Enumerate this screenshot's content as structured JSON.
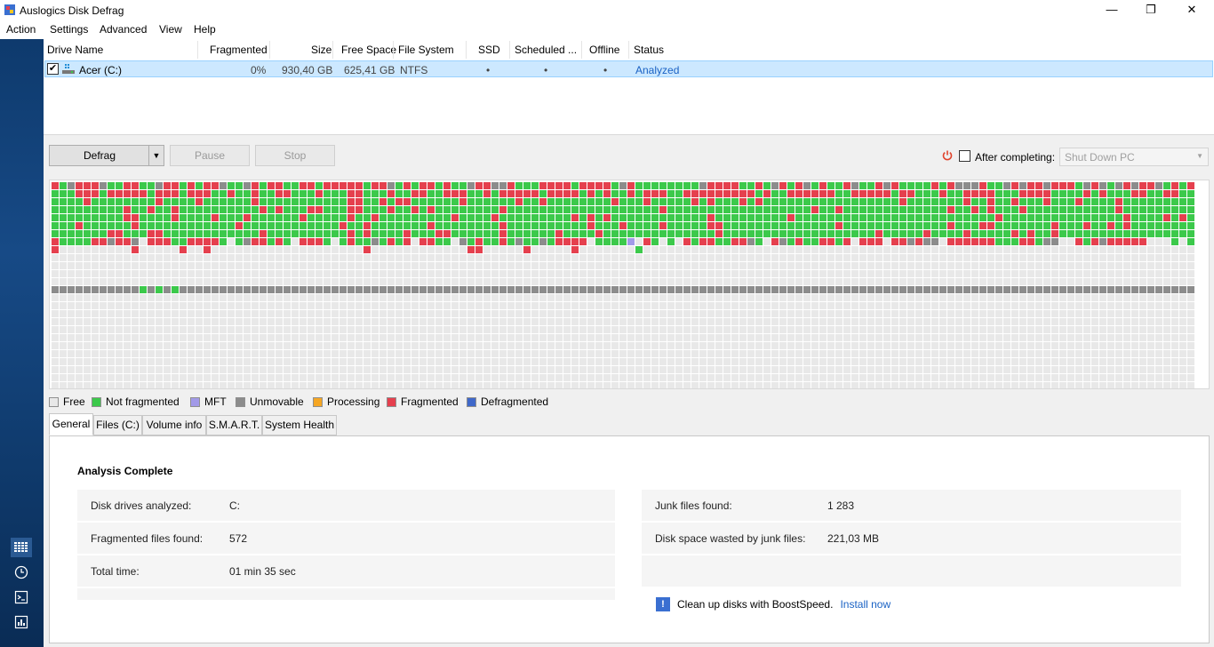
{
  "window": {
    "title": "Auslogics Disk Defrag",
    "minimize_glyph": "—",
    "maximize_glyph": "❐",
    "close_glyph": "✕"
  },
  "menu": [
    "Action",
    "Settings",
    "Advanced",
    "View",
    "Help"
  ],
  "columns": {
    "drive_name": "Drive Name",
    "fragmented": "Fragmented",
    "size": "Size",
    "free_space": "Free Space",
    "file_system": "File System",
    "ssd": "SSD",
    "scheduled": "Scheduled ...",
    "offline": "Offline",
    "status": "Status"
  },
  "drive": {
    "checked": true,
    "name": "Acer (C:)",
    "fragmented": "0%",
    "size": "930,40 GB",
    "free_space": "625,41 GB",
    "file_system": "NTFS",
    "ssd": "•",
    "scheduled": "•",
    "offline": "•",
    "status": "Analyzed"
  },
  "toolbar": {
    "defrag_label": "Defrag",
    "pause_label": "Pause",
    "stop_label": "Stop",
    "after_completing_label": "After completing:",
    "after_completing_checked": false,
    "after_completing_value": "Shut Down PC"
  },
  "legend": [
    {
      "label": "Free",
      "color": "#e8e8e8"
    },
    {
      "label": "Not fragmented",
      "color": "#3cc94b"
    },
    {
      "label": "MFT",
      "color": "#a29ae8"
    },
    {
      "label": "Unmovable",
      "color": "#8c8c8c"
    },
    {
      "label": "Processing",
      "color": "#f5a623"
    },
    {
      "label": "Fragmented",
      "color": "#e5404e"
    },
    {
      "label": "Defragmented",
      "color": "#3f68c9"
    }
  ],
  "tabs": [
    "General",
    "Files (C:)",
    "Volume info",
    "S.M.A.R.T.",
    "System Health"
  ],
  "active_tab": "General",
  "general": {
    "title": "Analysis Complete",
    "left": [
      {
        "label": "Disk drives analyzed:",
        "value": "C:"
      },
      {
        "label": "Fragmented files found:",
        "value": "572"
      },
      {
        "label": "Total time:",
        "value": "01 min 35 sec"
      }
    ],
    "right": [
      {
        "label": "Junk files found:",
        "value": "1 283"
      },
      {
        "label": "Disk space wasted by junk files:",
        "value": "221,03 MB"
      },
      {
        "label": "",
        "value": ""
      }
    ],
    "promo_text": "Clean up disks with BoostSpeed.",
    "promo_link": "Install now"
  },
  "sidebar_icons": [
    "cluster-map-icon",
    "clock-icon",
    "terminal-icon",
    "report-icon"
  ],
  "colors": {
    "free": "#e8e8e8",
    "not_fragmented": "#3cc94b",
    "fragmented": "#e5404e",
    "unmovable": "#8c8c8c",
    "mft": "#a29ae8",
    "accent": "#1a62c4",
    "sidebar": "#174a86"
  }
}
